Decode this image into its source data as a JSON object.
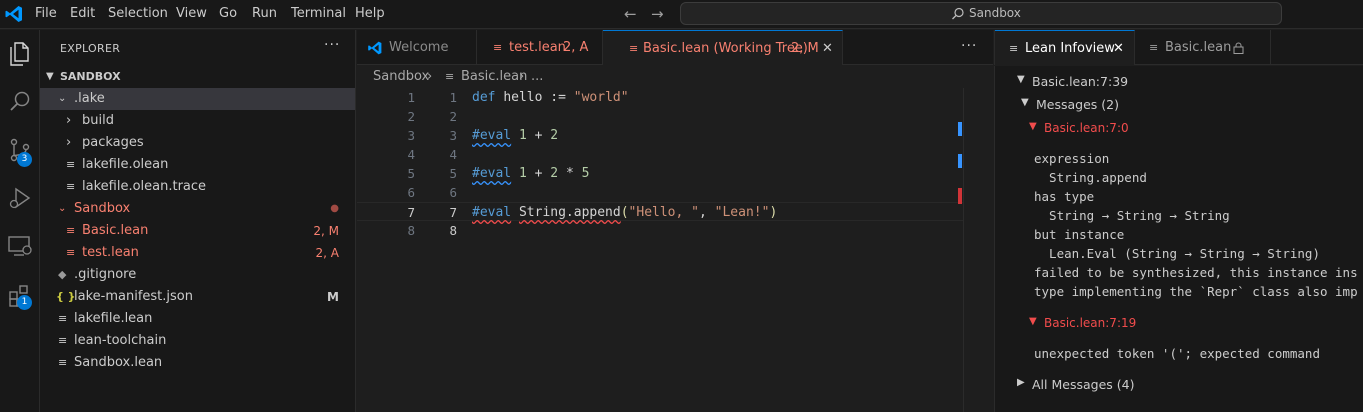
{
  "titlebar": {
    "menu": [
      "File",
      "Edit",
      "Selection",
      "View",
      "Go",
      "Run",
      "Terminal",
      "Help"
    ],
    "search_text": "Sandbox"
  },
  "activitybar": {
    "scm_badge": "3",
    "extensions_badge": "1"
  },
  "explorer": {
    "title": "EXPLORER",
    "root": "SANDBOX",
    "items": [
      {
        "label": ".lake",
        "deco": ""
      },
      {
        "label": "build",
        "deco": ""
      },
      {
        "label": "packages",
        "deco": ""
      },
      {
        "label": "lakefile.olean",
        "deco": ""
      },
      {
        "label": "lakefile.olean.trace",
        "deco": ""
      },
      {
        "label": "Sandbox",
        "deco": "●"
      },
      {
        "label": "Basic.lean",
        "deco": "2, M"
      },
      {
        "label": "test.lean",
        "deco": "2, A"
      },
      {
        "label": ".gitignore",
        "deco": ""
      },
      {
        "label": "lake-manifest.json",
        "deco": "M"
      },
      {
        "label": "lakefile.lean",
        "deco": ""
      },
      {
        "label": "lean-toolchain",
        "deco": ""
      },
      {
        "label": "Sandbox.lean",
        "deco": ""
      }
    ]
  },
  "tabs": [
    {
      "label": "Welcome"
    },
    {
      "label": "test.lean",
      "deco": "2, A"
    },
    {
      "label": "Basic.lean (Working Tree)",
      "deco": "2, M"
    }
  ],
  "breadcrumb": {
    "folder": "Sandbox",
    "file": "Basic.lean",
    "rest": "..."
  },
  "editor": {
    "line_numbers": [
      "1",
      "2",
      "3",
      "4",
      "5",
      "6",
      "7",
      "8"
    ]
  },
  "infoview": {
    "tab_main": "Lean Infoview",
    "tab_second": "Basic.lean",
    "position": "Basic.lean:7:39",
    "messages_header": "Messages (2)",
    "msg1_header": "Basic.lean:7:0",
    "msg1_lines": [
      "expression",
      "  String.append",
      "has type",
      "  String → String → String",
      "but instance",
      "  Lean.Eval (String → String → String)",
      "failed to be synthesized, this instance ins",
      "type implementing the `Repr` class also imp"
    ],
    "msg2_header": "Basic.lean:7:19",
    "msg2_text": "unexpected token '('; expected command",
    "all_messages": "All Messages (4)"
  }
}
